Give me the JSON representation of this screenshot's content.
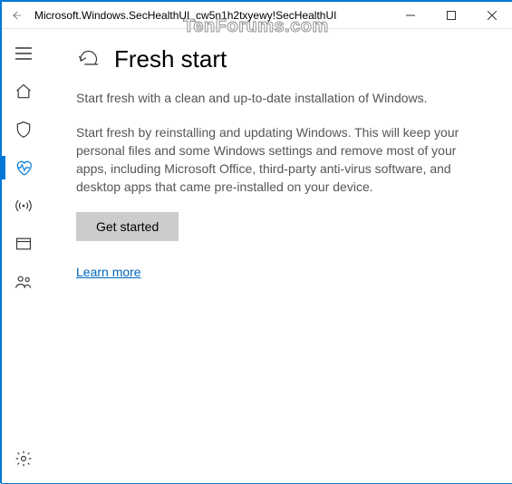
{
  "window": {
    "title": "Microsoft.Windows.SecHealthUI_cw5n1h2txyewy!SecHealthUI"
  },
  "watermark": "TenForums.com",
  "sidebar": {
    "items": [
      {
        "id": "menu",
        "label": "Menu"
      },
      {
        "id": "home",
        "label": "Home"
      },
      {
        "id": "virus",
        "label": "Virus & threat protection"
      },
      {
        "id": "perf",
        "label": "Device performance & health"
      },
      {
        "id": "network",
        "label": "Firewall & network protection"
      },
      {
        "id": "app",
        "label": "App & browser control"
      },
      {
        "id": "family",
        "label": "Family options"
      },
      {
        "id": "settings",
        "label": "Settings"
      }
    ],
    "active": "perf"
  },
  "page": {
    "title": "Fresh start",
    "lead": "Start fresh with a clean and up-to-date installation of Windows.",
    "body": "Start fresh by reinstalling and updating Windows. This will keep your personal files and some Windows settings and remove most of your apps, including Microsoft Office, third-party anti-virus software, and desktop apps that came pre-installed on your device.",
    "primaryButton": "Get started",
    "link": "Learn more"
  }
}
